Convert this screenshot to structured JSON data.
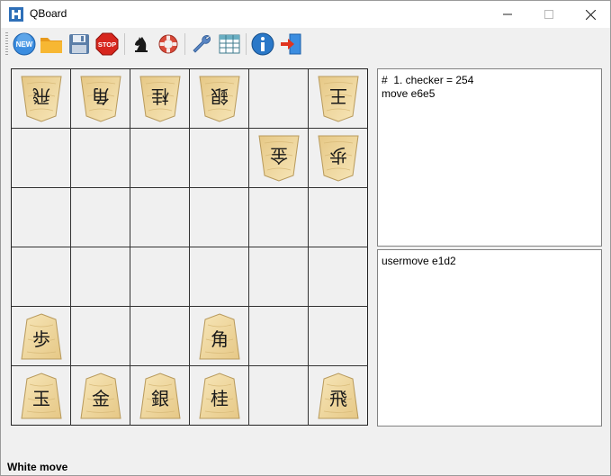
{
  "window": {
    "title": "QBoard"
  },
  "toolbar": {
    "buttons": [
      {
        "name": "new-game-button",
        "icon": "new-icon",
        "tooltip": ""
      },
      {
        "name": "open-button",
        "icon": "folder-icon"
      },
      {
        "name": "save-button",
        "icon": "floppy-icon"
      },
      {
        "name": "stop-button",
        "icon": "stop-icon",
        "label": "STOP"
      },
      {
        "name": "engine-button",
        "icon": "knight-icon"
      },
      {
        "name": "help-ring-button",
        "icon": "lifebuoy-icon"
      },
      {
        "name": "settings-button",
        "icon": "wrench-icon"
      },
      {
        "name": "table-button",
        "icon": "table-icon"
      },
      {
        "name": "info-button",
        "icon": "info-icon"
      },
      {
        "name": "exit-button",
        "icon": "exit-icon"
      }
    ],
    "stop_label": "STOP",
    "new_label": "NEW"
  },
  "board": {
    "rows": [
      [
        {
          "piece": "飛",
          "flipped": true
        },
        {
          "piece": "角",
          "flipped": true
        },
        {
          "piece": "桂",
          "flipped": true
        },
        {
          "piece": "銀",
          "flipped": true
        },
        {
          "piece": "",
          "flipped": false
        },
        {
          "piece": "王",
          "flipped": true
        }
      ],
      [
        {
          "piece": "",
          "flipped": false
        },
        {
          "piece": "",
          "flipped": false
        },
        {
          "piece": "",
          "flipped": false
        },
        {
          "piece": "",
          "flipped": false
        },
        {
          "piece": "金",
          "flipped": true
        },
        {
          "piece": "歩",
          "flipped": true
        }
      ],
      [
        {
          "piece": "",
          "flipped": false
        },
        {
          "piece": "",
          "flipped": false
        },
        {
          "piece": "",
          "flipped": false
        },
        {
          "piece": "",
          "flipped": false
        },
        {
          "piece": "",
          "flipped": false
        },
        {
          "piece": "",
          "flipped": false
        }
      ],
      [
        {
          "piece": "",
          "flipped": false
        },
        {
          "piece": "",
          "flipped": false
        },
        {
          "piece": "",
          "flipped": false
        },
        {
          "piece": "",
          "flipped": false
        },
        {
          "piece": "",
          "flipped": false
        },
        {
          "piece": "",
          "flipped": false
        }
      ],
      [
        {
          "piece": "歩",
          "flipped": false
        },
        {
          "piece": "",
          "flipped": false
        },
        {
          "piece": "",
          "flipped": false
        },
        {
          "piece": "角",
          "flipped": false
        },
        {
          "piece": "",
          "flipped": false
        },
        {
          "piece": "",
          "flipped": false
        }
      ],
      [
        {
          "piece": "玉",
          "flipped": false
        },
        {
          "piece": "金",
          "flipped": false
        },
        {
          "piece": "銀",
          "flipped": false
        },
        {
          "piece": "桂",
          "flipped": false
        },
        {
          "piece": "",
          "flipped": false
        },
        {
          "piece": "飛",
          "flipped": false
        }
      ]
    ]
  },
  "engine_log": {
    "lines": [
      "#  1. checker = 254",
      "move e6e5"
    ]
  },
  "user_log": {
    "lines": [
      "usermove e1d2"
    ]
  },
  "status": {
    "text": "White move"
  },
  "colors": {
    "piece_wood": "#f2dca4",
    "piece_edge": "#b89a5c",
    "stop_red": "#d7261e",
    "new_blue": "#2a7fd4"
  }
}
